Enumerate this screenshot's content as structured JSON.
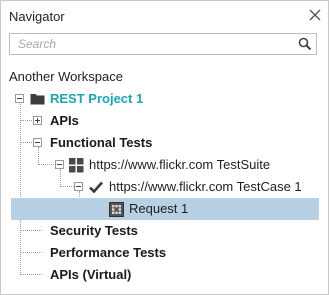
{
  "panel": {
    "title": "Navigator"
  },
  "search": {
    "placeholder": "Search",
    "value": ""
  },
  "icons": {
    "close": "close-icon",
    "search": "search-icon",
    "folder": "folder-icon",
    "grid": "test-suite-grid-icon",
    "check": "checkmark-icon",
    "request": "request-icon"
  },
  "colors": {
    "project_text": "#1aa6b7",
    "selection_bg": "#b7d0e3"
  },
  "tree": {
    "workspace": "Another Workspace",
    "project": "REST Project 1",
    "apis": "APIs",
    "functional_tests": "Functional Tests",
    "test_suite": "https://www.flickr.com TestSuite",
    "test_case": "https://www.flickr.com TestCase 1",
    "request": "Request 1",
    "security_tests": "Security Tests",
    "performance_tests": "Performance Tests",
    "apis_virtual": "APIs (Virtual)"
  }
}
